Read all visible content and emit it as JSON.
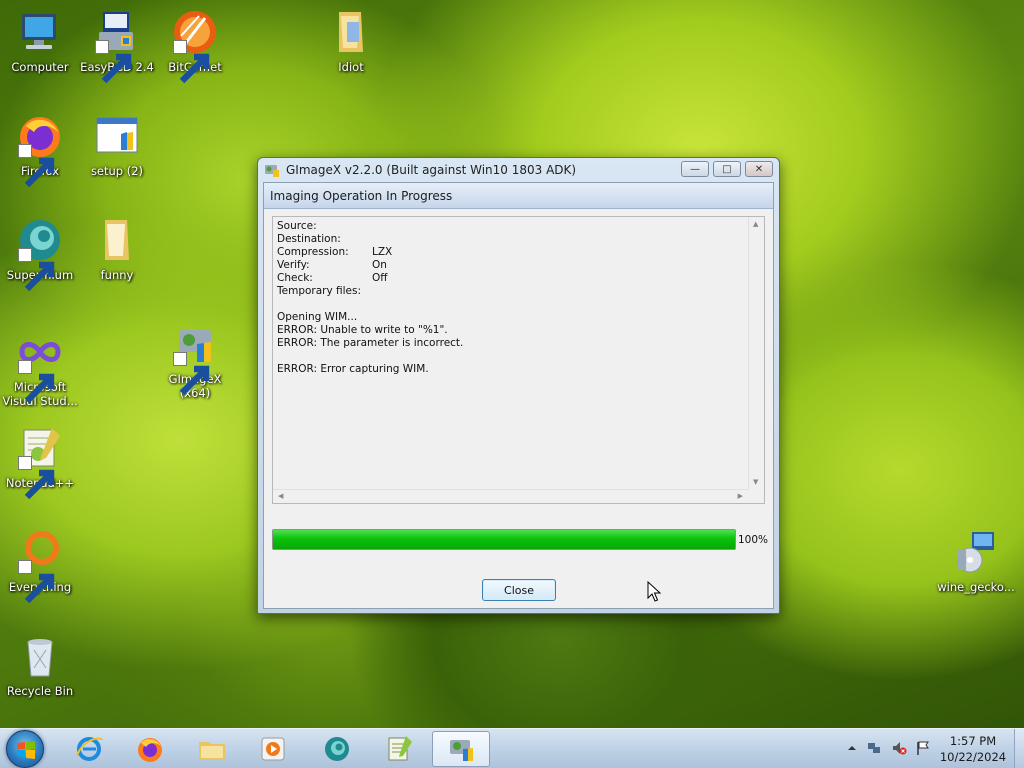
{
  "desktop": {
    "icons": [
      {
        "label": "Computer"
      },
      {
        "label": "EasyBCD 2.4"
      },
      {
        "label": "BitComet"
      },
      {
        "label": "Idiot"
      },
      {
        "label": "Firefox"
      },
      {
        "label": "setup (2)"
      },
      {
        "label": "Supermium"
      },
      {
        "label": "funny"
      },
      {
        "label": "Microsoft Visual Stud..."
      },
      {
        "label": "GImageX (x64)"
      },
      {
        "label": "Notepad++"
      },
      {
        "label": "Everything"
      },
      {
        "label": "Recycle Bin"
      },
      {
        "label": "wine_gecko..."
      }
    ]
  },
  "window": {
    "title": "GImageX v2.2.0 (Built against Win10 1803 ADK)",
    "header": "Imaging Operation In Progress",
    "log": {
      "fields": [
        {
          "key": "Source:",
          "value": ""
        },
        {
          "key": "Destination:",
          "value": ""
        },
        {
          "key": "Compression:",
          "value": "LZX"
        },
        {
          "key": "Verify:",
          "value": "On"
        },
        {
          "key": "Check:",
          "value": "Off"
        },
        {
          "key": "Temporary files:",
          "value": ""
        }
      ],
      "messages": [
        "Opening WIM...",
        "ERROR: Unable to write to \"%1\".",
        "ERROR: The parameter is incorrect.",
        "ERROR: Error capturing WIM."
      ]
    },
    "progress": {
      "percent": 100,
      "label": "100%"
    },
    "close_label": "Close"
  },
  "taskbar": {
    "clock_time": "1:57 PM",
    "clock_date": "10/22/2024"
  },
  "colors": {
    "progress_green": "#0cc10c",
    "taskbar": "#bfd2e6"
  }
}
